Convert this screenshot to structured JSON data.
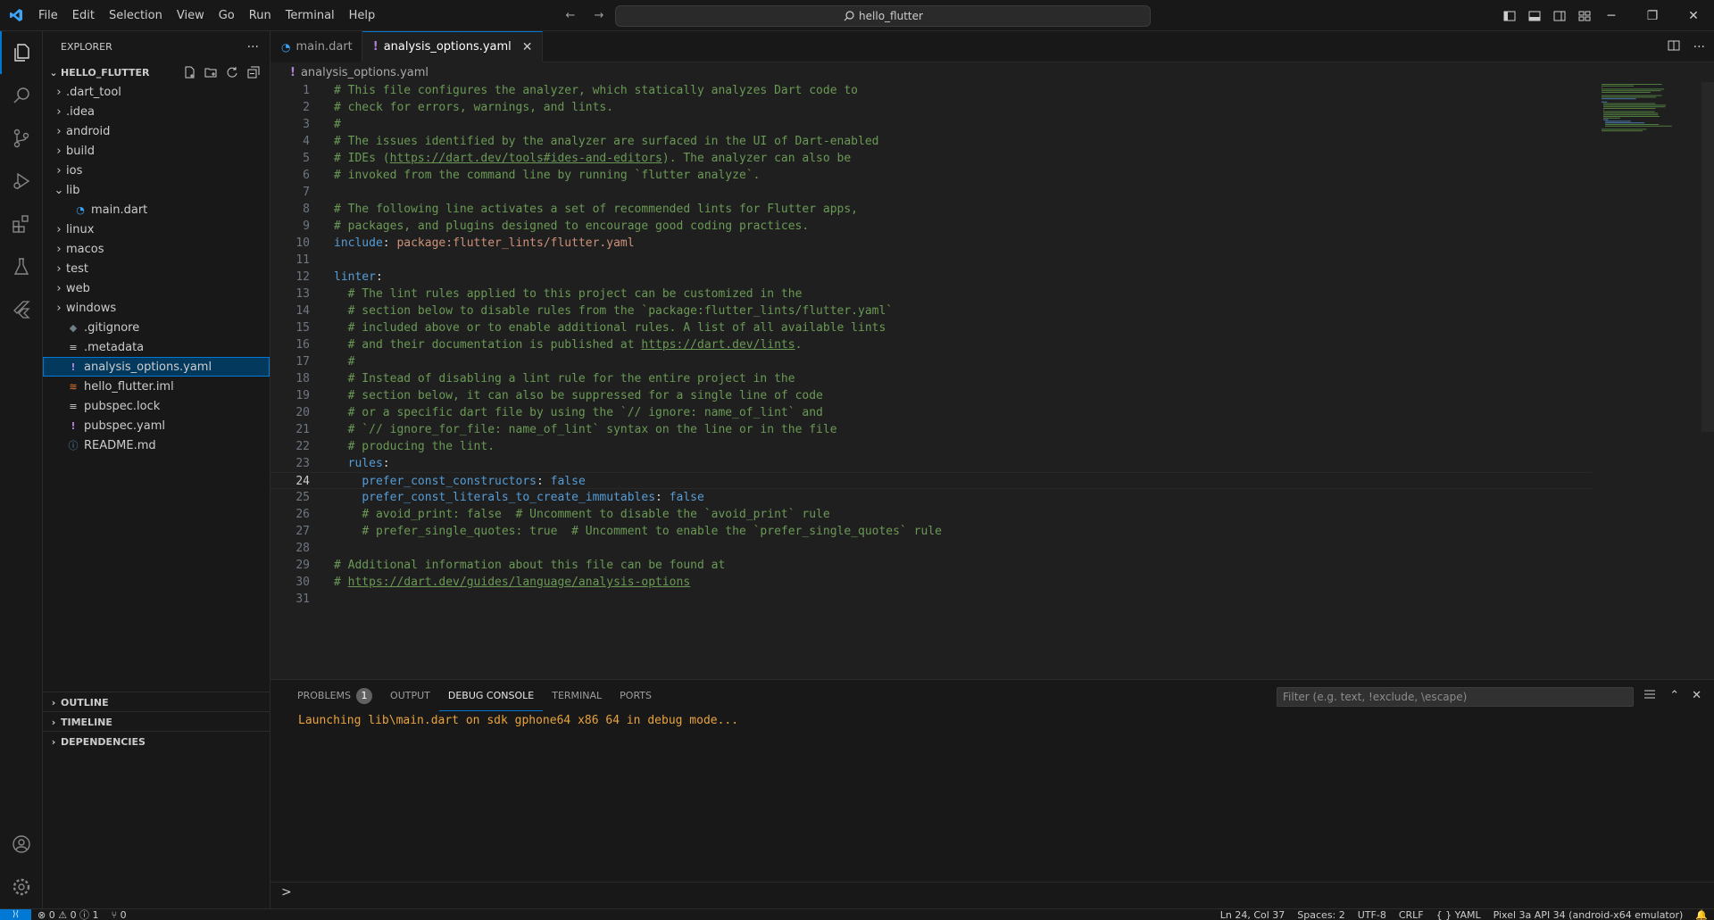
{
  "titlebar": {
    "menu": [
      "File",
      "Edit",
      "Selection",
      "View",
      "Go",
      "Run",
      "Terminal",
      "Help"
    ],
    "search_text": "hello_flutter",
    "window_controls": [
      "minimize",
      "restore",
      "close"
    ]
  },
  "activity_bar": [
    "explorer-icon",
    "search-icon",
    "source-control-icon",
    "run-debug-icon",
    "extensions-icon",
    "testing-icon",
    "flutter-icon",
    "accounts-icon",
    "manage-icon"
  ],
  "sidebar": {
    "title": "EXPLORER",
    "project": "HELLO_FLUTTER",
    "tree": [
      {
        "label": ".dart_tool",
        "type": "folder",
        "expanded": false
      },
      {
        "label": ".idea",
        "type": "folder",
        "expanded": false
      },
      {
        "label": "android",
        "type": "folder",
        "expanded": false
      },
      {
        "label": "build",
        "type": "folder",
        "expanded": false
      },
      {
        "label": "ios",
        "type": "folder",
        "expanded": false
      },
      {
        "label": "lib",
        "type": "folder",
        "expanded": true
      },
      {
        "label": "main.dart",
        "type": "dart"
      },
      {
        "label": "linux",
        "type": "folder",
        "expanded": false
      },
      {
        "label": "macos",
        "type": "folder",
        "expanded": false
      },
      {
        "label": "test",
        "type": "folder",
        "expanded": false
      },
      {
        "label": "web",
        "type": "folder",
        "expanded": false
      },
      {
        "label": "windows",
        "type": "folder",
        "expanded": false
      },
      {
        "label": ".gitignore",
        "type": "git"
      },
      {
        "label": ".metadata",
        "type": "text"
      },
      {
        "label": "analysis_options.yaml",
        "type": "yaml",
        "selected": true
      },
      {
        "label": "hello_flutter.iml",
        "type": "iml"
      },
      {
        "label": "pubspec.lock",
        "type": "text"
      },
      {
        "label": "pubspec.yaml",
        "type": "yaml"
      },
      {
        "label": "README.md",
        "type": "info"
      }
    ],
    "sections": [
      "OUTLINE",
      "TIMELINE",
      "DEPENDENCIES"
    ]
  },
  "editor": {
    "tabs": [
      {
        "label": "main.dart",
        "active": false
      },
      {
        "label": "analysis_options.yaml",
        "active": true
      }
    ],
    "breadcrumb": "analysis_options.yaml",
    "current_line": 24,
    "lines": [
      "# This file configures the analyzer, which statically analyzes Dart code to",
      "# check for errors, warnings, and lints.",
      "#",
      "# The issues identified by the analyzer are surfaced in the UI of Dart-enabled",
      "# IDEs (https://dart.dev/tools#ides-and-editors). The analyzer can also be",
      "# invoked from the command line by running `flutter analyze`.",
      "",
      "# The following line activates a set of recommended lints for Flutter apps,",
      "# packages, and plugins designed to encourage good coding practices.",
      "include: package:flutter_lints/flutter.yaml",
      "",
      "linter:",
      "  # The lint rules applied to this project can be customized in the",
      "  # section below to disable rules from the `package:flutter_lints/flutter.yaml`",
      "  # included above or to enable additional rules. A list of all available lints",
      "  # and their documentation is published at https://dart.dev/lints.",
      "  #",
      "  # Instead of disabling a lint rule for the entire project in the",
      "  # section below, it can also be suppressed for a single line of code",
      "  # or a specific dart file by using the `// ignore: name_of_lint` and",
      "  # `// ignore_for_file: name_of_lint` syntax on the line or in the file",
      "  # producing the lint.",
      "  rules:",
      "    prefer_const_constructors: false",
      "    prefer_const_literals_to_create_immutables: false",
      "    # avoid_print: false  # Uncomment to disable the `avoid_print` rule",
      "    # prefer_single_quotes: true  # Uncomment to enable the `prefer_single_quotes` rule",
      "",
      "# Additional information about this file can be found at",
      "# https://dart.dev/guides/language/analysis-options",
      ""
    ]
  },
  "panel": {
    "tabs": [
      {
        "label": "PROBLEMS",
        "badge": "1",
        "active": false
      },
      {
        "label": "OUTPUT",
        "active": false
      },
      {
        "label": "DEBUG CONSOLE",
        "active": true
      },
      {
        "label": "TERMINAL",
        "active": false
      },
      {
        "label": "PORTS",
        "active": false
      }
    ],
    "filter_placeholder": "Filter (e.g. text, !exclude, \\escape)",
    "console_output": "Launching lib\\main.dart on sdk gphone64 x86 64 in debug mode...",
    "prompt": ">"
  },
  "statusbar": {
    "problems": "⊗ 0 ⚠ 0 ⓘ 1",
    "ports": "⑂ 0",
    "cursor": "Ln 24, Col 37",
    "spaces": "Spaces: 2",
    "encoding": "UTF-8",
    "eol": "CRLF",
    "language": "{ } YAML",
    "device": "Pixel 3a API 34 (android-x64 emulator)"
  },
  "colors": {
    "accent": "#0078d4",
    "comment": "#6a9955",
    "keyword": "#569cd6",
    "string": "#ce9178",
    "console": "#e8a33e"
  }
}
